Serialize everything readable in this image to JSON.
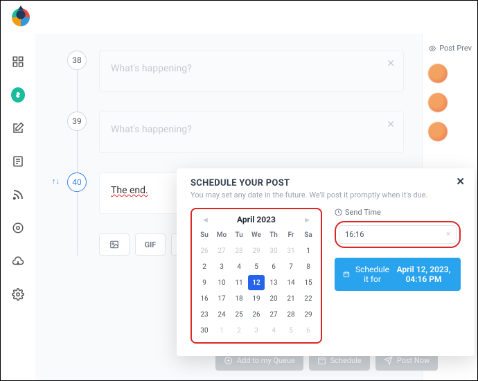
{
  "sidebar": {
    "items": [
      {
        "name": "dashboard-icon"
      },
      {
        "name": "dollar-icon",
        "active": true
      },
      {
        "name": "compose-icon"
      },
      {
        "name": "document-icon"
      },
      {
        "name": "rss-icon"
      },
      {
        "name": "sync-icon"
      },
      {
        "name": "cloud-download-icon"
      },
      {
        "name": "settings-icon"
      }
    ]
  },
  "thread": {
    "posts": [
      {
        "num": "38",
        "placeholder": "What's happening?",
        "ghost": true
      },
      {
        "num": "39",
        "placeholder": "What's happening?",
        "ghost": true
      },
      {
        "num": "40",
        "text": "The end.",
        "reorderable": true
      }
    ]
  },
  "toolbar": {
    "image": "",
    "gif": "GIF",
    "upload": ""
  },
  "preview": {
    "label": "Post Prev"
  },
  "dialog": {
    "title": "SCHEDULE YOUR POST",
    "subtitle": "You may set any date in the future. We'll post it promptly when it's due.",
    "calendar": {
      "month": "April 2023",
      "weekdays": [
        "Su",
        "Mo",
        "Tu",
        "We",
        "Th",
        "Fr",
        "Sa"
      ],
      "cells": [
        {
          "d": "26",
          "o": true
        },
        {
          "d": "27",
          "o": true
        },
        {
          "d": "28",
          "o": true
        },
        {
          "d": "29",
          "o": true
        },
        {
          "d": "30",
          "o": true
        },
        {
          "d": "31",
          "o": true
        },
        {
          "d": "1"
        },
        {
          "d": "2"
        },
        {
          "d": "3"
        },
        {
          "d": "4"
        },
        {
          "d": "5"
        },
        {
          "d": "6"
        },
        {
          "d": "7"
        },
        {
          "d": "8"
        },
        {
          "d": "9"
        },
        {
          "d": "10"
        },
        {
          "d": "11"
        },
        {
          "d": "12",
          "sel": true
        },
        {
          "d": "13"
        },
        {
          "d": "14"
        },
        {
          "d": "15"
        },
        {
          "d": "16"
        },
        {
          "d": "17"
        },
        {
          "d": "18"
        },
        {
          "d": "19"
        },
        {
          "d": "20"
        },
        {
          "d": "21"
        },
        {
          "d": "22"
        },
        {
          "d": "23"
        },
        {
          "d": "24"
        },
        {
          "d": "25"
        },
        {
          "d": "26"
        },
        {
          "d": "27"
        },
        {
          "d": "28"
        },
        {
          "d": "29"
        },
        {
          "d": "30"
        },
        {
          "d": "1",
          "o": true
        },
        {
          "d": "2",
          "o": true
        },
        {
          "d": "3",
          "o": true
        },
        {
          "d": "4",
          "o": true
        },
        {
          "d": "5",
          "o": true
        },
        {
          "d": "6",
          "o": true
        }
      ]
    },
    "send_time_label": "Send Time",
    "time_value": "16:16",
    "schedule_prefix": "Schedule it for",
    "schedule_datetime": "April 12, 2023, 04:16 PM"
  },
  "actions": {
    "queue": "Add to my Queue",
    "schedule": "Schedule",
    "post_now": "Post Now"
  }
}
